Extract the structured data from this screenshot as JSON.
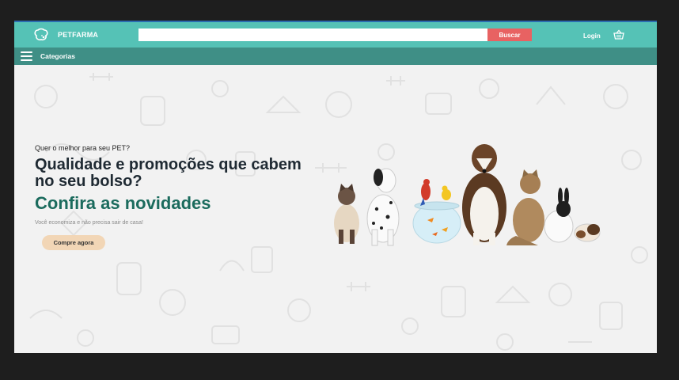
{
  "header": {
    "brand": "PETFARMA",
    "search_placeholder": "",
    "search_button": "Buscar",
    "login": "Login",
    "icons": [
      "paw-logo-icon",
      "basket-icon"
    ]
  },
  "category_bar": {
    "label": "Categorias",
    "icon": "menu-icon"
  },
  "hero": {
    "tagline": "Quer o melhor para seu PET?",
    "headline": "Qualidade e promoções que cabem no seu bolso?",
    "highlight": "Confira as novidades",
    "subtitle": "Você economiza e não precisa sair de casa!",
    "cta": "Compre agora"
  },
  "colors": {
    "header": "#55c2b6",
    "category_bar": "#3f8f86",
    "search_button": "#e86262",
    "highlight_text": "#1b6b5d",
    "cta": "#f2d6b6"
  }
}
